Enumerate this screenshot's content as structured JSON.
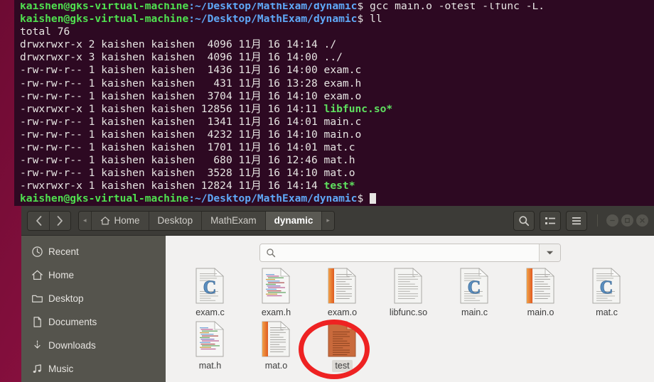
{
  "terminal": {
    "prompt_user": "kaishen@gks-virtual-machine",
    "prompt_path": ":~/Desktop/MathExam/dynamic",
    "prompt_tail": "$",
    "lines": [
      {
        "type": "prompt",
        "command": " gcc main.o -otest -lfunc -L."
      },
      {
        "type": "prompt",
        "command": " ll"
      },
      {
        "type": "plain",
        "text": "total 76"
      },
      {
        "type": "ls",
        "perms": "drwxrwxr-x",
        "links": "2",
        "owner": "kaishen",
        "group": "kaishen",
        "size": "4096",
        "month": "11月",
        "day": "16",
        "time": "14:14",
        "name": "./",
        "style": "dir"
      },
      {
        "type": "ls",
        "perms": "drwxrwxr-x",
        "links": "3",
        "owner": "kaishen",
        "group": "kaishen",
        "size": "4096",
        "month": "11月",
        "day": "16",
        "time": "14:00",
        "name": "../",
        "style": "dir"
      },
      {
        "type": "ls",
        "perms": "-rw-rw-r--",
        "links": "1",
        "owner": "kaishen",
        "group": "kaishen",
        "size": "1436",
        "month": "11月",
        "day": "16",
        "time": "14:00",
        "name": "exam.c",
        "style": "plain"
      },
      {
        "type": "ls",
        "perms": "-rw-rw-r--",
        "links": "1",
        "owner": "kaishen",
        "group": "kaishen",
        "size": "431",
        "month": "11月",
        "day": "16",
        "time": "13:28",
        "name": "exam.h",
        "style": "plain"
      },
      {
        "type": "ls",
        "perms": "-rw-rw-r--",
        "links": "1",
        "owner": "kaishen",
        "group": "kaishen",
        "size": "3704",
        "month": "11月",
        "day": "16",
        "time": "14:10",
        "name": "exam.o",
        "style": "plain"
      },
      {
        "type": "ls",
        "perms": "-rwxrwxr-x",
        "links": "1",
        "owner": "kaishen",
        "group": "kaishen",
        "size": "12856",
        "month": "11月",
        "day": "16",
        "time": "14:11",
        "name": "libfunc.so*",
        "style": "exec"
      },
      {
        "type": "ls",
        "perms": "-rw-rw-r--",
        "links": "1",
        "owner": "kaishen",
        "group": "kaishen",
        "size": "1341",
        "month": "11月",
        "day": "16",
        "time": "14:01",
        "name": "main.c",
        "style": "plain"
      },
      {
        "type": "ls",
        "perms": "-rw-rw-r--",
        "links": "1",
        "owner": "kaishen",
        "group": "kaishen",
        "size": "4232",
        "month": "11月",
        "day": "16",
        "time": "14:10",
        "name": "main.o",
        "style": "plain"
      },
      {
        "type": "ls",
        "perms": "-rw-rw-r--",
        "links": "1",
        "owner": "kaishen",
        "group": "kaishen",
        "size": "1701",
        "month": "11月",
        "day": "16",
        "time": "14:01",
        "name": "mat.c",
        "style": "plain"
      },
      {
        "type": "ls",
        "perms": "-rw-rw-r--",
        "links": "1",
        "owner": "kaishen",
        "group": "kaishen",
        "size": "680",
        "month": "11月",
        "day": "16",
        "time": "12:46",
        "name": "mat.h",
        "style": "plain"
      },
      {
        "type": "ls",
        "perms": "-rw-rw-r--",
        "links": "1",
        "owner": "kaishen",
        "group": "kaishen",
        "size": "3528",
        "month": "11月",
        "day": "16",
        "time": "14:10",
        "name": "mat.o",
        "style": "plain"
      },
      {
        "type": "ls",
        "perms": "-rwxrwxr-x",
        "links": "1",
        "owner": "kaishen",
        "group": "kaishen",
        "size": "12824",
        "month": "11月",
        "day": "16",
        "time": "14:14",
        "name": "test*",
        "style": "exec"
      },
      {
        "type": "prompt",
        "command": "",
        "cursor": true
      }
    ],
    "colors": {
      "background": "#2d0922",
      "text": "#e7e5e3",
      "user": "#4fe04f",
      "path": "#5fa8f7",
      "exec": "#5fe05f"
    }
  },
  "filemanager": {
    "nav": {
      "back_label": "‹",
      "forward_label": "›"
    },
    "breadcrumb": {
      "left_arrow": "◂",
      "right_arrow": "▸",
      "items": [
        {
          "label": "Home",
          "icon": "home-icon",
          "active": false
        },
        {
          "label": "Desktop",
          "icon": "",
          "active": false
        },
        {
          "label": "MathExam",
          "icon": "",
          "active": false
        },
        {
          "label": "dynamic",
          "icon": "",
          "active": true
        }
      ]
    },
    "header_buttons": [
      {
        "name": "search-button",
        "icon": "search-icon"
      },
      {
        "name": "view-options-button",
        "icon": "list-view-icon"
      },
      {
        "name": "menu-button",
        "icon": "hamburger-icon"
      }
    ],
    "window_controls": [
      {
        "name": "minimize-button",
        "glyph": "−"
      },
      {
        "name": "maximize-button",
        "glyph": "□"
      },
      {
        "name": "close-button",
        "glyph": "✕"
      }
    ],
    "sidebar": {
      "items": [
        {
          "label": "Recent",
          "icon": "clock-icon"
        },
        {
          "label": "Home",
          "icon": "home-icon"
        },
        {
          "label": "Desktop",
          "icon": "folder-icon"
        },
        {
          "label": "Documents",
          "icon": "document-icon"
        },
        {
          "label": "Downloads",
          "icon": "download-icon"
        },
        {
          "label": "Music",
          "icon": "music-icon"
        }
      ]
    },
    "search": {
      "value": "",
      "placeholder": "",
      "icon": "search-icon",
      "dropdown_icon": "chevron-down-icon"
    },
    "files": [
      {
        "name": "exam.c",
        "kind": "c-source",
        "selected": false
      },
      {
        "name": "exam.h",
        "kind": "header",
        "selected": false
      },
      {
        "name": "exam.o",
        "kind": "object",
        "selected": false
      },
      {
        "name": "libfunc.so",
        "kind": "plain",
        "selected": false
      },
      {
        "name": "main.c",
        "kind": "c-source",
        "selected": false
      },
      {
        "name": "main.o",
        "kind": "object",
        "selected": false
      },
      {
        "name": "mat.c",
        "kind": "c-source",
        "selected": false
      },
      {
        "name": "mat.h",
        "kind": "header",
        "selected": false
      },
      {
        "name": "mat.o",
        "kind": "object",
        "selected": false
      },
      {
        "name": "test",
        "kind": "executable",
        "selected": true
      }
    ]
  },
  "annotation": {
    "shape": "ellipse",
    "color": "#ee2222",
    "target": "test"
  }
}
